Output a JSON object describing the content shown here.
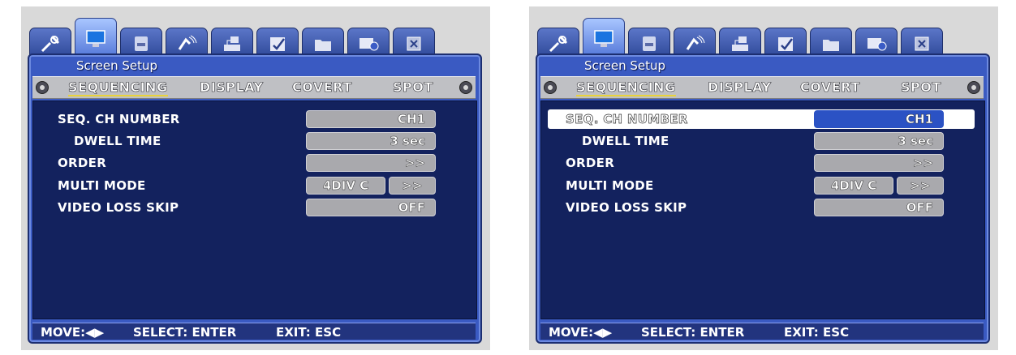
{
  "screens": [
    {
      "title": "Screen Setup",
      "subtabs": [
        "SEQUENCING",
        "DISPLAY",
        "COVERT",
        "SPOT"
      ],
      "rows": {
        "seq_ch_number": {
          "label": "SEQ. CH NUMBER",
          "value": "CH1"
        },
        "dwell_time": {
          "label": "DWELL TIME",
          "value": "3 sec"
        },
        "order": {
          "label": "ORDER",
          "value": ">>"
        },
        "multi_mode": {
          "label": "MULTI MODE",
          "value": "4DIV C",
          "value2": ">>"
        },
        "video_loss_skip": {
          "label": "VIDEO LOSS SKIP",
          "value": "OFF"
        }
      },
      "footer": {
        "move": "MOVE:◀▶",
        "select": "SELECT: ENTER",
        "exit": "EXIT: ESC"
      }
    },
    {
      "title": "Screen Setup",
      "subtabs": [
        "SEQUENCING",
        "DISPLAY",
        "COVERT",
        "SPOT"
      ],
      "rows": {
        "seq_ch_number": {
          "label": "SEQ. CH NUMBER",
          "value": "CH1"
        },
        "dwell_time": {
          "label": "DWELL TIME",
          "value": "3 sec"
        },
        "order": {
          "label": "ORDER",
          "value": ">>"
        },
        "multi_mode": {
          "label": "MULTI MODE",
          "value": "4DIV C",
          "value2": ">>"
        },
        "video_loss_skip": {
          "label": "VIDEO LOSS SKIP",
          "value": "OFF"
        }
      },
      "footer": {
        "move": "MOVE:◀▶",
        "select": "SELECT: ENTER",
        "exit": "EXIT: ESC"
      }
    }
  ],
  "icons": [
    "tools-icon",
    "monitor-icon",
    "hdd-icon",
    "camera-icon",
    "network-icon",
    "schedule-icon",
    "folder-icon",
    "backup-icon",
    "close-icon"
  ],
  "colors": {
    "highlight_row": "#ffffff",
    "highlight_value": "#2b52c4",
    "content_bg": "#13225e",
    "frame": "#3a5ac2"
  }
}
